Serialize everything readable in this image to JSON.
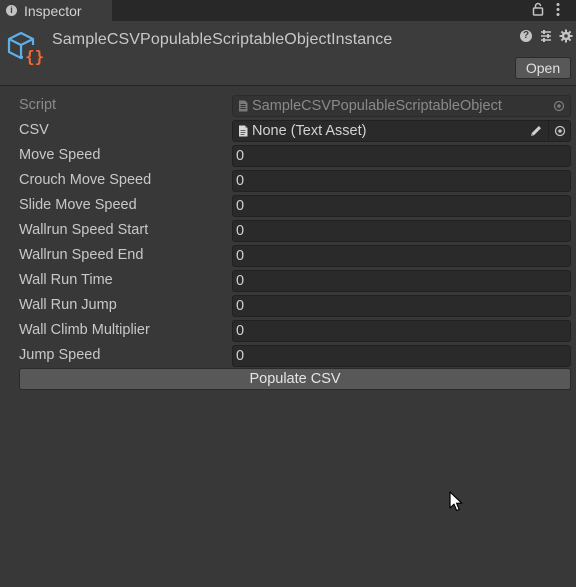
{
  "tab": {
    "title": "Inspector",
    "icons": [
      "info-icon",
      "lock-icon",
      "kebab-menu-icon"
    ]
  },
  "header": {
    "asset_name": "SampleCSVPopulableScriptableObjectInstance",
    "asset_icon": "scriptable-object-icon",
    "open_label": "Open",
    "icons": [
      "help-icon",
      "presets-icon",
      "gear-icon"
    ]
  },
  "fields": {
    "script": {
      "label": "Script",
      "value": "SampleCSVPopulableScriptableObject"
    },
    "csv": {
      "label": "CSV",
      "value": "None (Text Asset)"
    },
    "numeric": [
      {
        "label": "Move Speed",
        "value": "0"
      },
      {
        "label": "Crouch Move Speed",
        "value": "0"
      },
      {
        "label": "Slide Move Speed",
        "value": "0"
      },
      {
        "label": "Wallrun Speed Start",
        "value": "0"
      },
      {
        "label": "Wallrun Speed End",
        "value": "0"
      },
      {
        "label": "Wall Run Time",
        "value": "0"
      },
      {
        "label": "Wall Run Jump",
        "value": "0"
      },
      {
        "label": "Wall Climb Multiplier",
        "value": "0"
      },
      {
        "label": "Jump Speed",
        "value": "0"
      }
    ]
  },
  "actions": {
    "populate_label": "Populate CSV"
  },
  "colors": {
    "panel_bg": "#383838",
    "tabbar_bg": "#282828",
    "field_bg": "#2a2a2a",
    "button_bg": "#585858",
    "icon_blue": "#5fb0e8",
    "icon_orange": "#f0683a"
  }
}
